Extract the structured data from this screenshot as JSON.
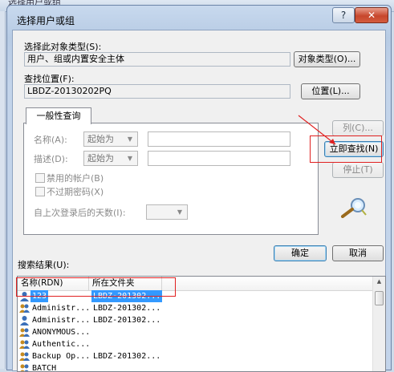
{
  "background_window": {
    "title": "选择用户或组"
  },
  "dialog": {
    "title": "选择用户或组",
    "help_label": "?",
    "close_label": "✕",
    "object_type": {
      "label": "选择此对象类型(S):",
      "value": "用户、组或内置安全主体",
      "button": "对象类型(O)..."
    },
    "location": {
      "label": "查找位置(F):",
      "value": "LBDZ-20130202PQ",
      "button": "位置(L)..."
    },
    "tab_label": "一般性查询",
    "query": {
      "name_label": "名称(A):",
      "name_mode": "起始为",
      "desc_label": "描述(D):",
      "desc_mode": "起始为",
      "disabled_accounts": "禁用的帐户(B)",
      "non_expiring": "不过期密码(X)",
      "days_label": "自上次登录后的天数(I):"
    },
    "buttons": {
      "columns": "列(C)...",
      "find_now": "立即查找(N)",
      "stop": "停止(T)",
      "ok": "确定",
      "cancel": "取消"
    },
    "results": {
      "label": "搜索结果(U):",
      "columns": [
        "名称(RDN)",
        "所在文件夹"
      ],
      "rows": [
        {
          "name": "123",
          "folder": "LBDZ-201302...",
          "selected": true
        },
        {
          "name": "Administr...",
          "folder": "LBDZ-201302..."
        },
        {
          "name": "Administr...",
          "folder": "LBDZ-201302..."
        },
        {
          "name": "ANONYMOUS...",
          "folder": ""
        },
        {
          "name": "Authentic...",
          "folder": ""
        },
        {
          "name": "Backup Op...",
          "folder": "LBDZ-201302..."
        },
        {
          "name": "BATCH",
          "folder": ""
        }
      ]
    }
  },
  "colors": {
    "selection": "#3399ff",
    "annotation": "#e02020",
    "close_button": "#c7472c"
  }
}
